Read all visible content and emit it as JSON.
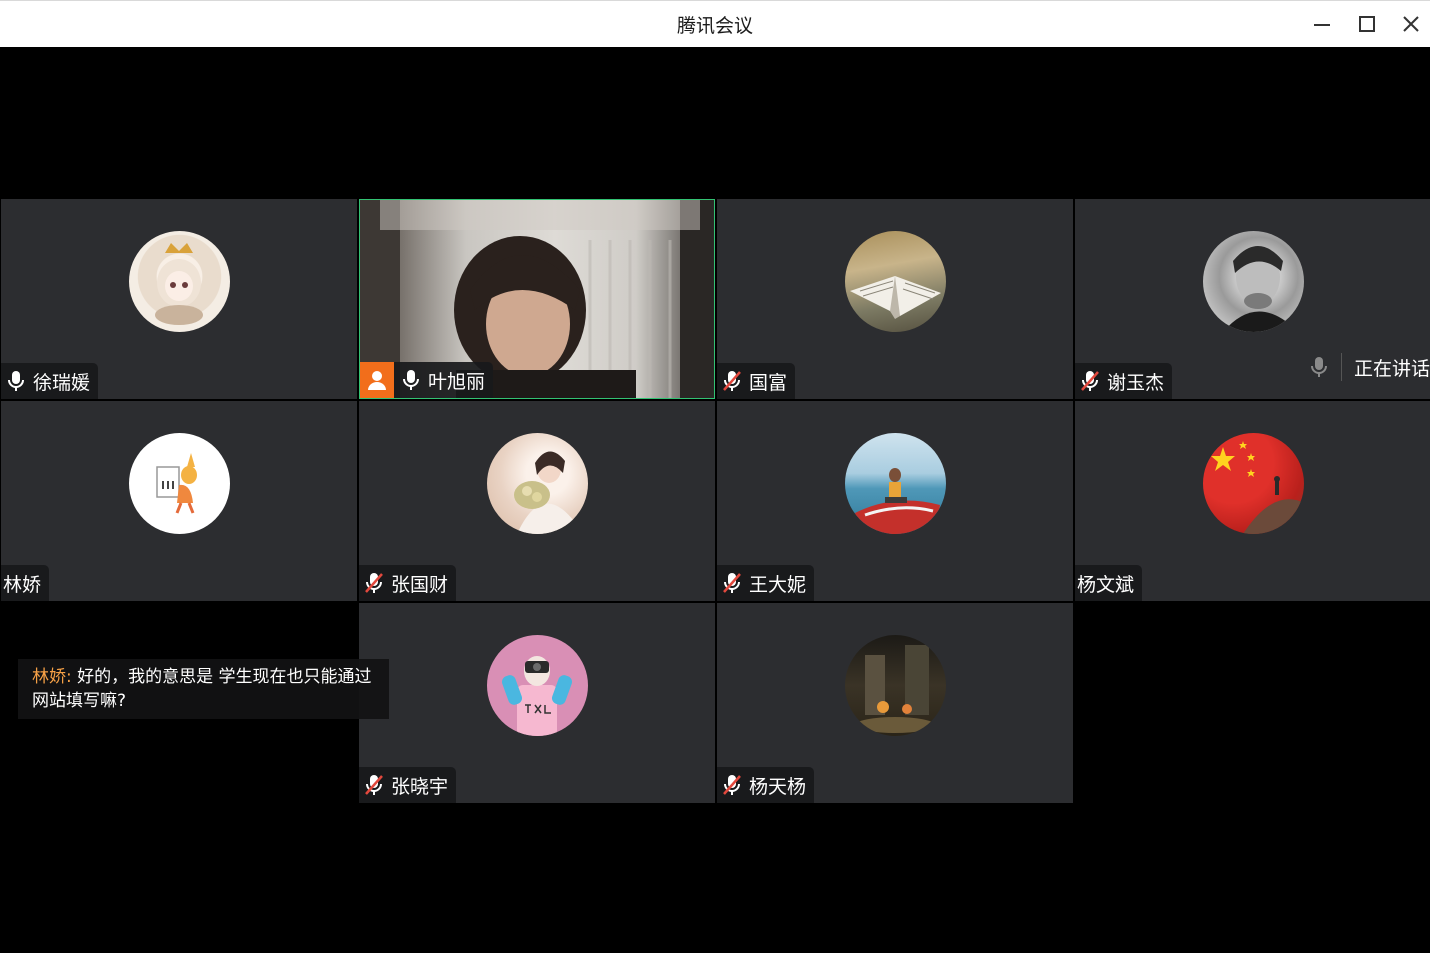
{
  "window": {
    "title": "腾讯会议"
  },
  "participants": [
    {
      "name": "徐瑞媛",
      "mic": "on"
    },
    {
      "name": "叶旭丽",
      "mic": "on",
      "host": true,
      "video": true
    },
    {
      "name": "国富",
      "mic": "muted"
    },
    {
      "name": "谢玉杰",
      "mic": "muted"
    },
    {
      "name": "林娇",
      "mic": "none"
    },
    {
      "name": "张国财",
      "mic": "muted"
    },
    {
      "name": "王大妮",
      "mic": "muted"
    },
    {
      "name": "杨文斌",
      "mic": "none"
    },
    {
      "name": "张晓宇",
      "mic": "muted"
    },
    {
      "name": "杨天杨",
      "mic": "muted"
    }
  ],
  "speaking_indicator": {
    "label": "正在讲话"
  },
  "chat": {
    "sender": "林娇:",
    "message": " 好的，我的意思是 学生现在也只能通过网站填写嘛?"
  },
  "colors": {
    "tile_bg": "#2c2d30",
    "active_border": "#33c273",
    "host_badge": "#f26e1b",
    "chat_sender": "#f5a046",
    "muted_red": "#e2483d"
  }
}
